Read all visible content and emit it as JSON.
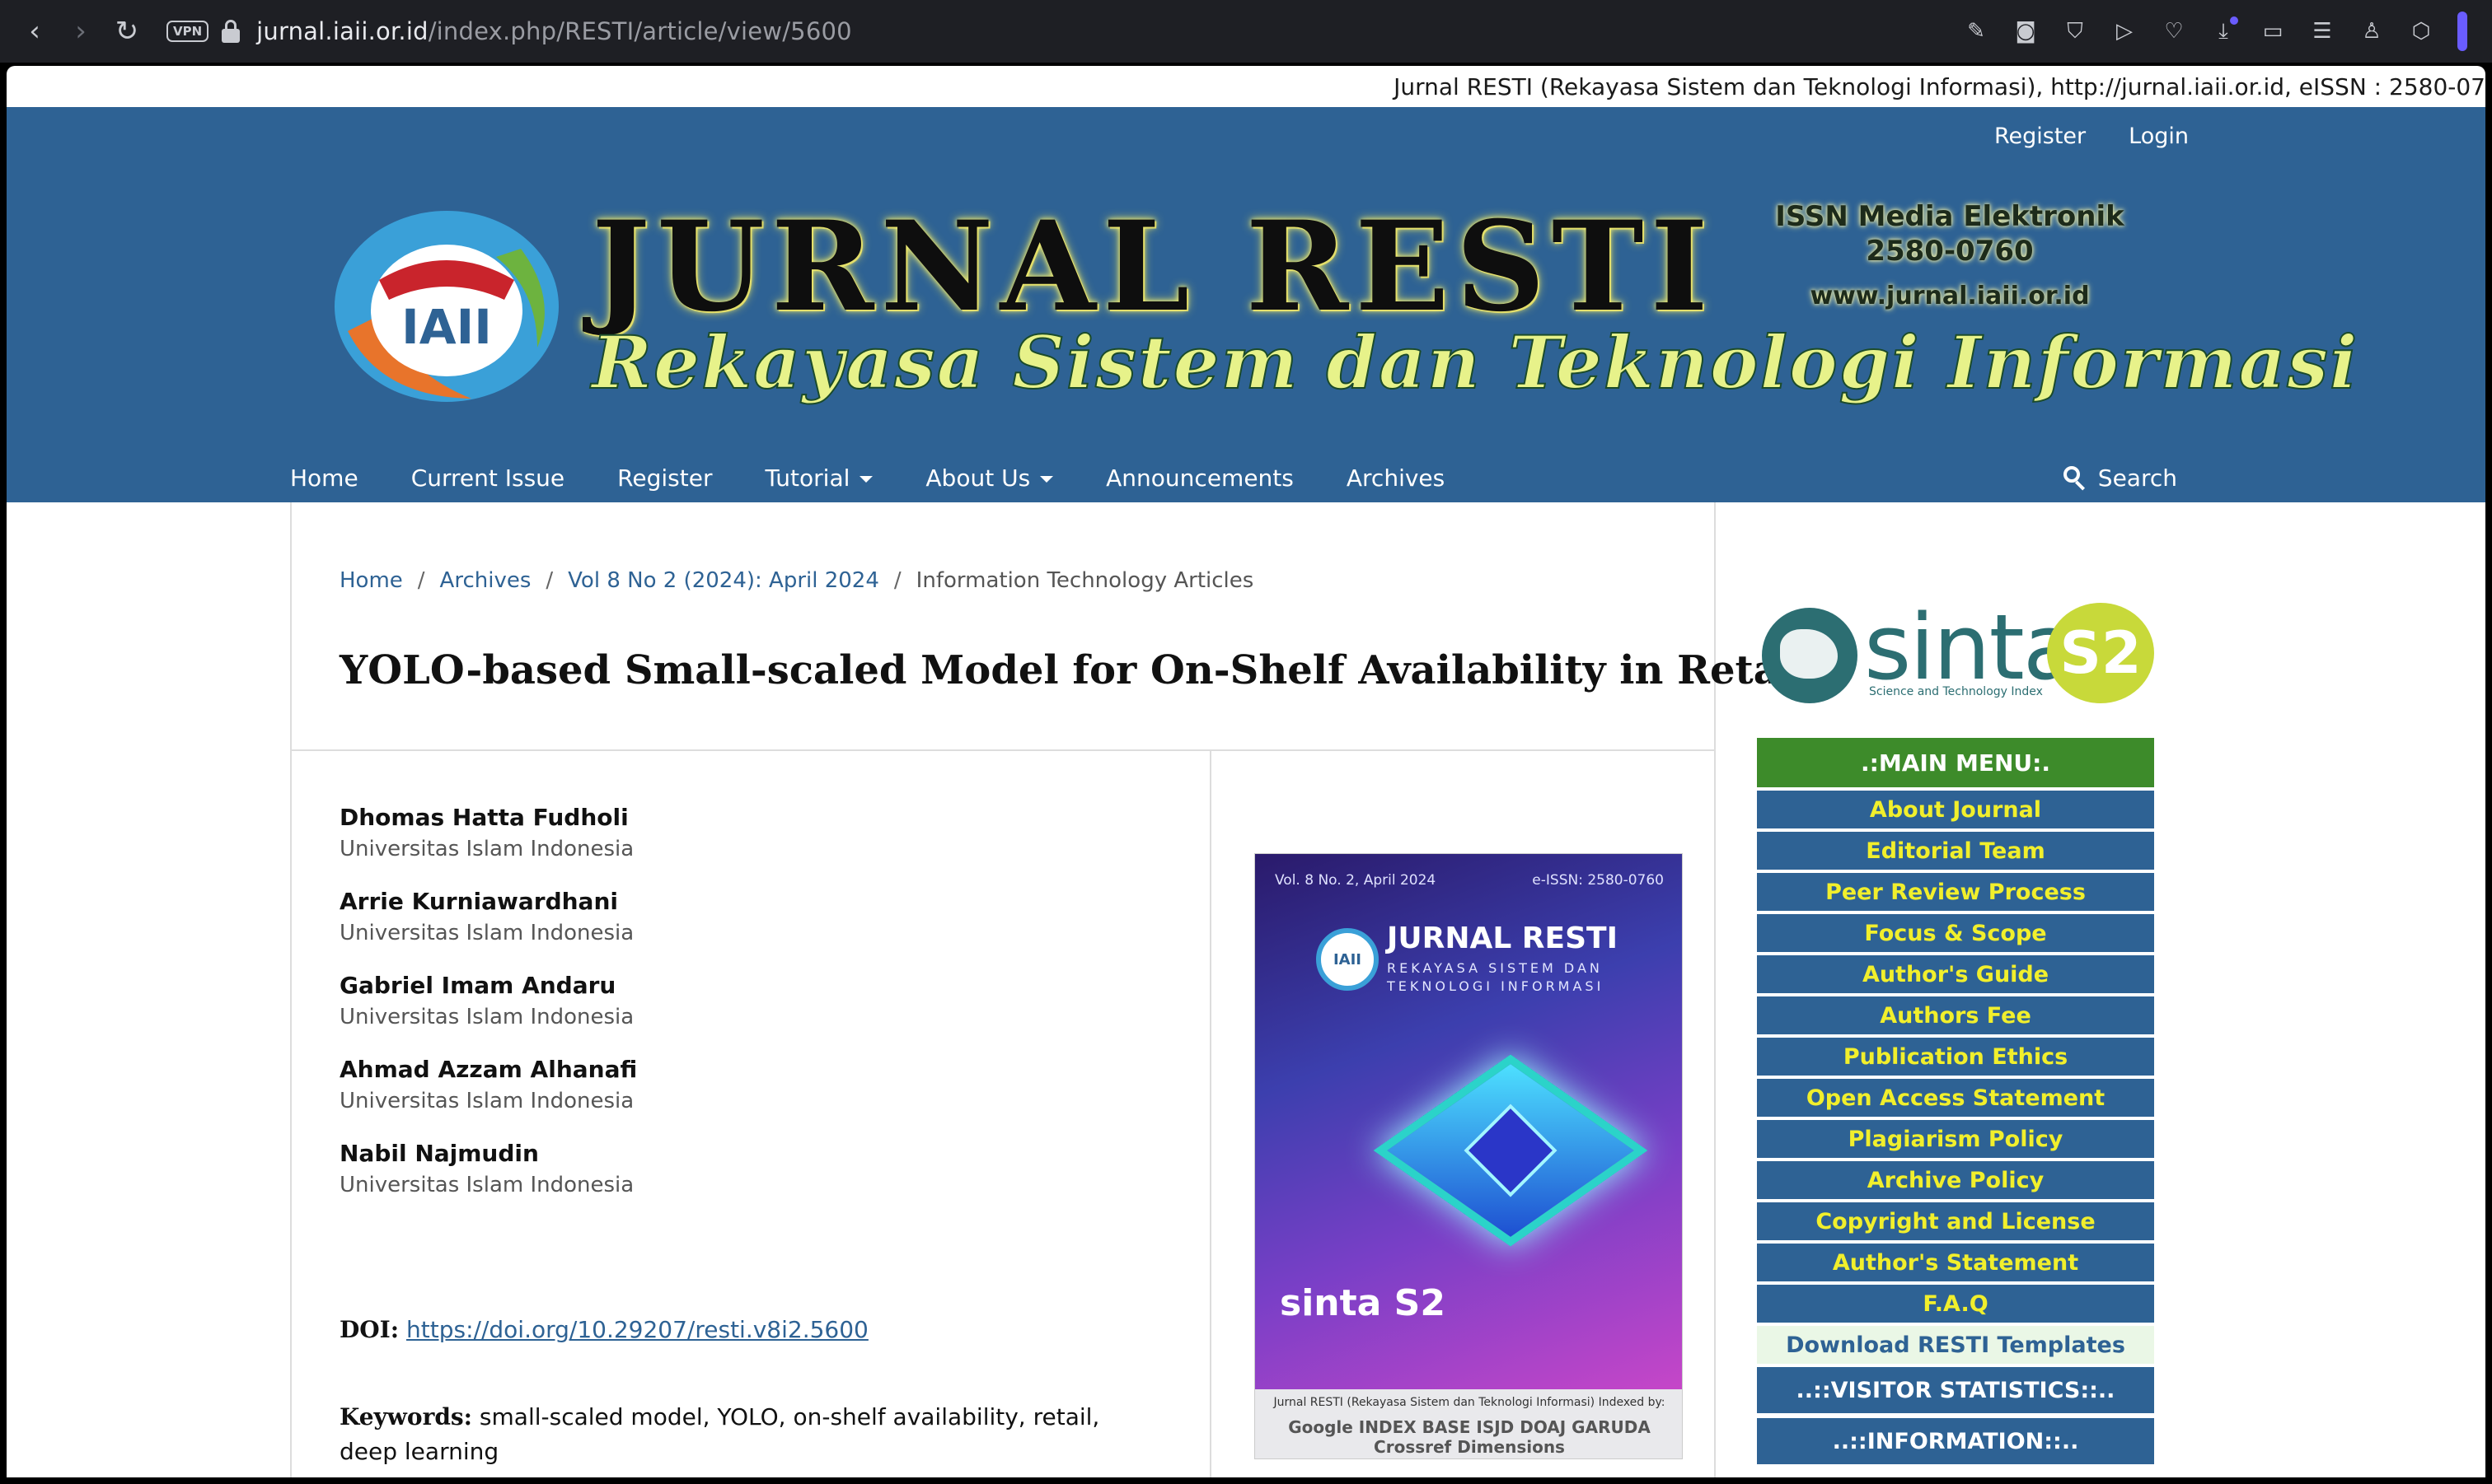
{
  "browser": {
    "url_host": "jurnal.iaii.or.id",
    "url_path": "/index.php/RESTI/article/view/5600",
    "vpn_label": "VPN",
    "icons": [
      "back-icon",
      "forward-icon",
      "reload-icon",
      "edit-icon",
      "camera-icon",
      "shield-icon",
      "play-icon",
      "heart-icon",
      "download-icon",
      "battery-icon",
      "menu-icon",
      "profile-icon",
      "cube-icon"
    ]
  },
  "marquee": "Jurnal RESTI (Rekayasa Sistem dan Teknologi Informasi), http://jurnal.iaii.or.id, eISSN : 2580-07",
  "user_nav": {
    "register": "Register",
    "login": "Login"
  },
  "banner": {
    "logo_text": "IAII",
    "title": "JURNAL RESTI",
    "subtitle": "Rekayasa Sistem dan Teknologi Informasi",
    "issn_line1": "ISSN Media Elektronik",
    "issn_line2": "2580-0760",
    "website": "www.jurnal.iaii.or.id"
  },
  "main_nav": {
    "items": [
      "Home",
      "Current Issue",
      "Register",
      "Tutorial",
      "About Us",
      "Announcements",
      "Archives"
    ],
    "search": "Search"
  },
  "breadcrumb": {
    "home": "Home",
    "archives": "Archives",
    "issue": "Vol 8 No 2 (2024): April 2024",
    "section": "Information Technology Articles",
    "separator": "/"
  },
  "article": {
    "title": "YOLO-based Small-scaled Model for On-Shelf Availability in Retail",
    "authors": [
      {
        "name": "Dhomas Hatta Fudholi",
        "affiliation": "Universitas Islam Indonesia"
      },
      {
        "name": "Arrie Kurniawardhani",
        "affiliation": "Universitas Islam Indonesia"
      },
      {
        "name": "Gabriel Imam Andaru",
        "affiliation": "Universitas Islam Indonesia"
      },
      {
        "name": "Ahmad Azzam Alhanafi",
        "affiliation": "Universitas Islam Indonesia"
      },
      {
        "name": "Nabil Najmudin",
        "affiliation": "Universitas Islam Indonesia"
      }
    ],
    "doi_label": "DOI:",
    "doi": "https://doi.org/10.29207/resti.v8i2.5600",
    "keywords_label": "Keywords:",
    "keywords": "small-scaled model, YOLO, on-shelf availability, retail, deep learning"
  },
  "cover": {
    "volume": "Vol. 8 No. 2, April 2024",
    "eissn": "e-ISSN: 2580-0760",
    "logo": "IAII",
    "title": "JURNAL RESTI",
    "subtitle1": "REKAYASA SISTEM DAN",
    "subtitle2": "TEKNOLOGI INFORMASI",
    "sinta": "sinta S2",
    "footer": "Jurnal RESTI (Rekayasa Sistem dan Teknologi Informasi) Indexed by:",
    "indexers": "Google  INDEX  BASE  ISJD  DOAJ  GARUDA  Crossref  Dimensions"
  },
  "sidebar": {
    "sinta_word": "sinta",
    "sinta_badge": "S2",
    "sinta_sub": "Science and Technology Index",
    "menu_title": ".:MAIN MENU:.",
    "menu_items": [
      "About Journal",
      "Editorial Team",
      "Peer Review Process",
      "Focus & Scope",
      "Author's Guide",
      "Authors Fee",
      "Publication Ethics",
      "Open Access Statement",
      "Plagiarism Policy",
      "Archive Policy",
      "Copyright and License",
      "Author's Statement",
      "F.A.Q"
    ],
    "download_templates": "Download RESTI Templates",
    "visitor_stats": "..::VISITOR STATISTICS::..",
    "information": "..::INFORMATION::.."
  },
  "colors": {
    "header_blue": "#2e6294",
    "menu_green": "#3d8b2a",
    "menu_text_yellow": "#f1ef2c"
  }
}
